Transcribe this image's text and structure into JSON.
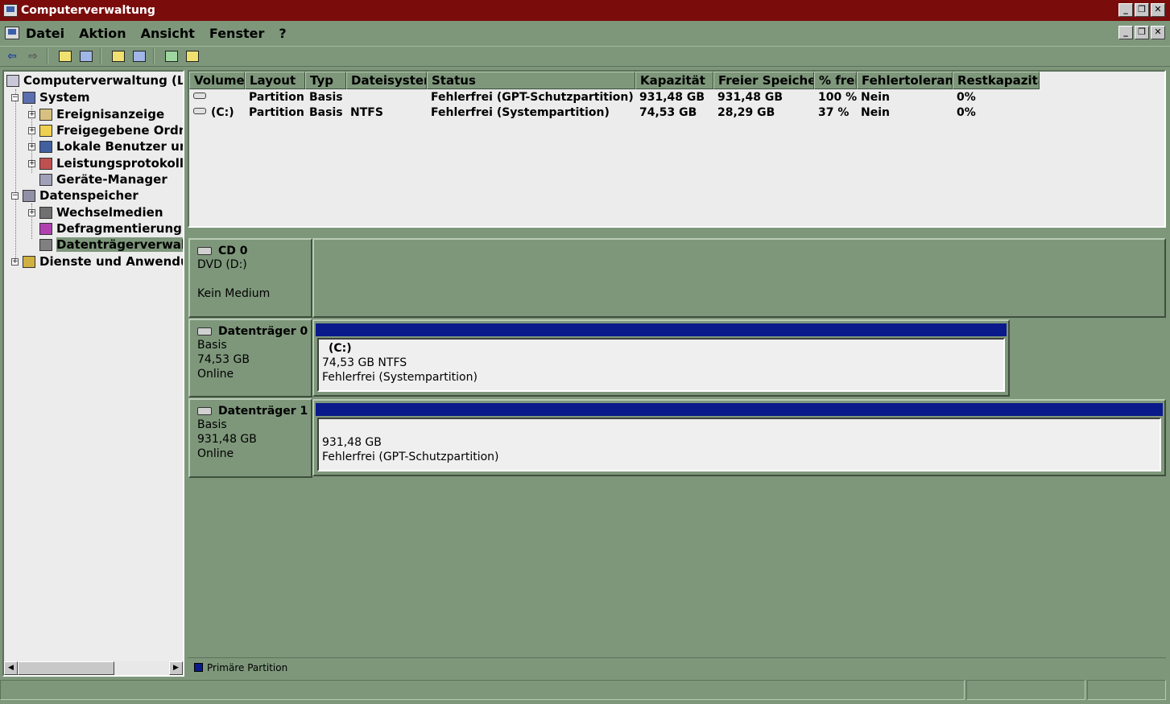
{
  "window": {
    "title": "Computerverwaltung"
  },
  "menu": {
    "items": [
      "Datei",
      "Aktion",
      "Ansicht",
      "Fenster",
      "?"
    ]
  },
  "window_buttons": {
    "minimize": "_",
    "restore": "❐",
    "close": "✕"
  },
  "tree": {
    "items": [
      {
        "label": "Computerverwaltung (Loka",
        "icon": "computer-management-icon"
      },
      {
        "label": "System",
        "icon": "system-tools-icon"
      },
      {
        "label": "Ereignisanzeige",
        "icon": "event-viewer-icon"
      },
      {
        "label": "Freigegebene Ordner",
        "icon": "shared-folders-icon"
      },
      {
        "label": "Lokale Benutzer und",
        "icon": "local-users-icon"
      },
      {
        "label": "Leistungsprotokolle u",
        "icon": "performance-logs-icon"
      },
      {
        "label": "Geräte-Manager",
        "icon": "device-manager-icon"
      },
      {
        "label": "Datenspeicher",
        "icon": "storage-icon"
      },
      {
        "label": "Wechselmedien",
        "icon": "removable-storage-icon"
      },
      {
        "label": "Defragmentierung",
        "icon": "defragmenter-icon"
      },
      {
        "label": "Datenträgerverwaltung",
        "icon": "disk-management-icon"
      },
      {
        "label": "Dienste und Anwendungen",
        "icon": "services-icon"
      }
    ]
  },
  "volumes": {
    "columns": [
      "Volume",
      "Layout",
      "Typ",
      "Dateisystem",
      "Status",
      "Kapazität",
      "Freier Speicher",
      "% frei",
      "Fehlertoleranz",
      "Restkapazität"
    ],
    "rows": [
      [
        "",
        "Partition",
        "Basis",
        "",
        "Fehlerfrei (GPT-Schutzpartition)",
        "931,48 GB",
        "931,48 GB",
        "100 %",
        "Nein",
        "0%"
      ],
      [
        "(C:)",
        "Partition",
        "Basis",
        "NTFS",
        "Fehlerfrei (Systempartition)",
        "74,53 GB",
        "28,29 GB",
        "37 %",
        "Nein",
        "0%"
      ]
    ]
  },
  "disks": {
    "cd0": {
      "name": "CD 0",
      "type": "DVD (D:)",
      "status": "Kein Medium"
    },
    "disk0": {
      "name": "Datenträger 0",
      "type": "Basis",
      "size": "74,53 GB",
      "state": "Online",
      "partition": {
        "volume": "(C:)",
        "size_fs": "74,53 GB NTFS",
        "status": "Fehlerfrei (Systempartition)"
      }
    },
    "disk1": {
      "name": "Datenträger 1",
      "type": "Basis",
      "size": "931,48 GB",
      "state": "Online",
      "partition": {
        "size": "931,48 GB",
        "status": "Fehlerfrei (GPT-Schutzpartition)"
      }
    }
  },
  "legend": {
    "primary_partition": "Primäre Partition"
  },
  "colors": {
    "titlebar": "#7a0c0c",
    "theme": "#7e977b",
    "partition_primary": "#0a1a8a"
  }
}
